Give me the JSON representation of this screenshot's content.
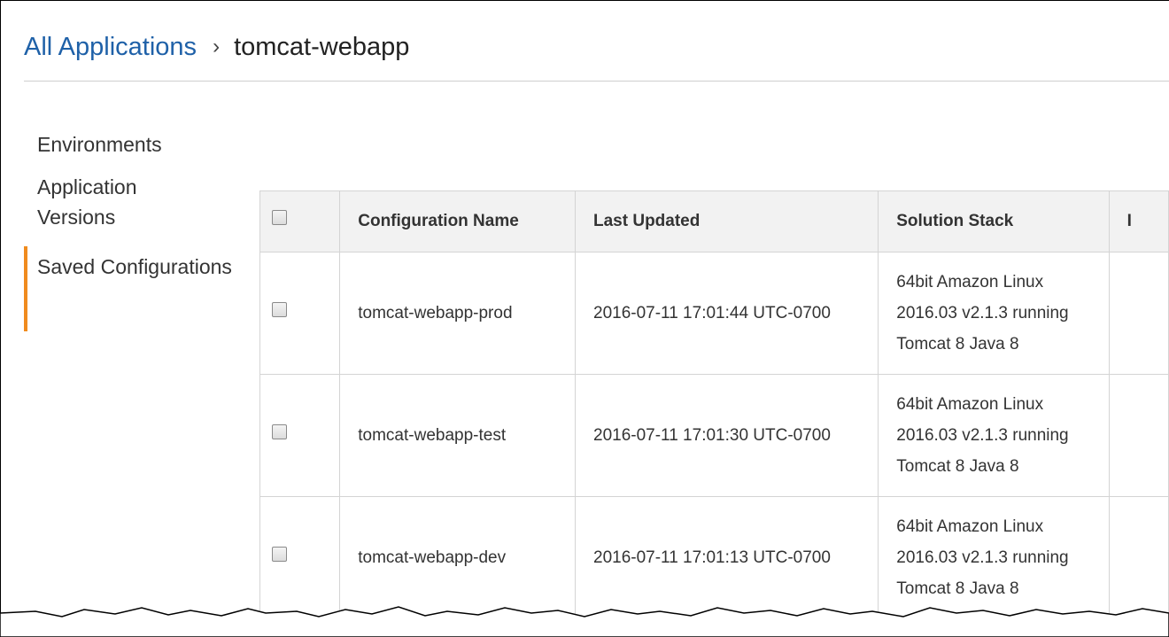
{
  "breadcrumb": {
    "root": "All Applications",
    "separator": "›",
    "current": "tomcat-webapp"
  },
  "sidebar": {
    "items": [
      {
        "label": "Environments",
        "active": false
      },
      {
        "label": "Application Versions",
        "active": false
      },
      {
        "label": "Saved Configurations",
        "active": true
      }
    ]
  },
  "table": {
    "headers": [
      "Configuration Name",
      "Last Updated",
      "Solution Stack",
      "I"
    ],
    "rows": [
      {
        "name": "tomcat-webapp-prod",
        "updated": "2016-07-11 17:01:44 UTC-0700",
        "stack": "64bit Amazon Linux 2016.03 v2.1.3 running Tomcat 8 Java 8"
      },
      {
        "name": "tomcat-webapp-test",
        "updated": "2016-07-11 17:01:30 UTC-0700",
        "stack": "64bit Amazon Linux 2016.03 v2.1.3 running Tomcat 8 Java 8"
      },
      {
        "name": "tomcat-webapp-dev",
        "updated": "2016-07-11 17:01:13 UTC-0700",
        "stack": "64bit Amazon Linux 2016.03 v2.1.3 running Tomcat 8 Java 8"
      }
    ]
  },
  "colors": {
    "link": "#1f61a8",
    "active_indicator": "#f08b1e",
    "header_bg": "#f2f2f2",
    "border": "#d4d4d4"
  }
}
